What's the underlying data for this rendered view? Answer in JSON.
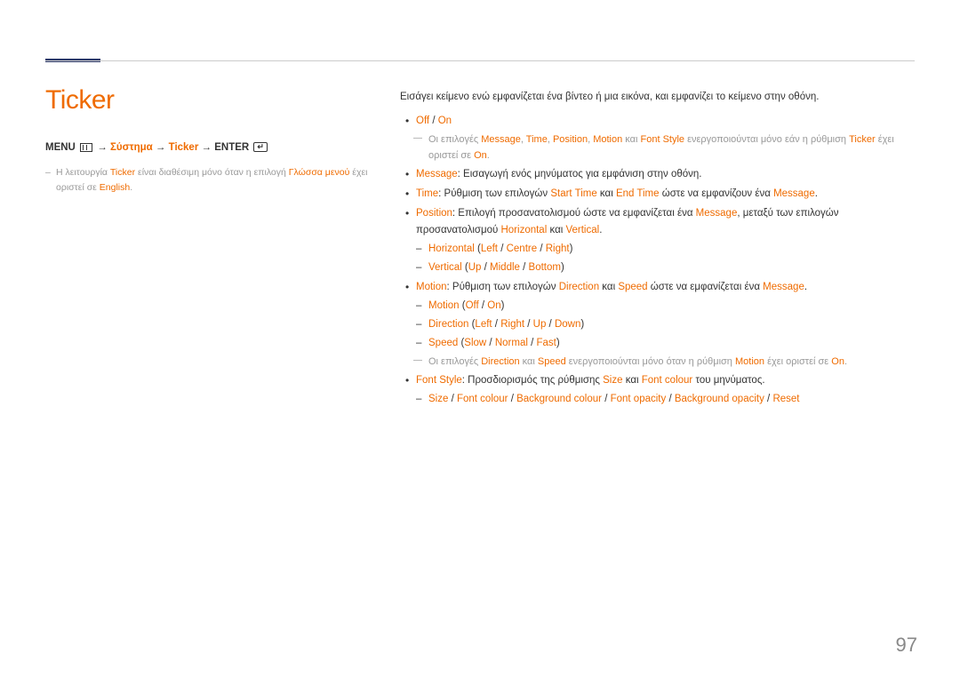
{
  "title": "Ticker",
  "breadcrumb": {
    "menu": "MENU",
    "arrow": "→",
    "system": "Σύστημα",
    "ticker": "Ticker",
    "enter": "ENTER"
  },
  "left_note": {
    "p1": "Η λειτουργία ",
    "ticker": "Ticker",
    "p2": " είναι διαθέσιμη μόνο όταν η επιλογή ",
    "lang": "Γλώσσα μενού",
    "p3": " έχει οριστεί σε ",
    "english": "English",
    "p4": "."
  },
  "intro": "Εισάγει κείμενο ενώ εμφανίζεται ένα βίντεο ή μια εικόνα, και εμφανίζει το κείμενο στην οθόνη.",
  "off_on": {
    "off": "Off",
    "slash": " / ",
    "on": "On"
  },
  "offon_note": {
    "p1": "Οι επιλογές ",
    "msg": "Message",
    "c1": ", ",
    "time": "Time",
    "c2": ", ",
    "pos": "Position",
    "c3": ", ",
    "mot": "Motion",
    "c4": " και ",
    "fs": "Font Style",
    "p2": " ενεργοποιούνται μόνο εάν η ρύθμιση ",
    "tk": "Ticker",
    "p3": " έχει οριστεί σε ",
    "on": "On",
    "p4": "."
  },
  "message": {
    "lbl": "Message",
    "txt": ": Εισαγωγή ενός μηνύματος για εμφάνιση στην οθόνη."
  },
  "time": {
    "lbl": "Time",
    "p1": ": Ρύθμιση των επιλογών ",
    "st": "Start Time",
    "and": " και ",
    "et": "End Time",
    "p2": " ώστε να εμφανίζουν ένα ",
    "msg": "Message",
    "p3": "."
  },
  "position": {
    "lbl": "Position",
    "p1": ": Επιλογή προσανατολισμού ώστε να εμφανίζεται ένα ",
    "msg": "Message",
    "p2": ", μεταξύ των επιλογών προσανατολισμού ",
    "hor": "Horizontal",
    "and": " και ",
    "ver": "Vertical",
    "p3": "."
  },
  "pos_h": {
    "lbl": "Horizontal",
    "o1": "Left",
    "o2": "Centre",
    "o3": "Right"
  },
  "pos_v": {
    "lbl": "Vertical",
    "o1": "Up",
    "o2": "Middle",
    "o3": "Bottom"
  },
  "motion": {
    "lbl": "Motion",
    "p1": ": Ρύθμιση των επιλογών ",
    "dir": "Direction",
    "and": " και ",
    "spd": "Speed",
    "p2": " ώστε να εμφανίζεται ένα ",
    "msg": "Message",
    "p3": "."
  },
  "mot_onoff": {
    "lbl": "Motion",
    "o1": "Off",
    "o2": "On"
  },
  "mot_dir": {
    "lbl": "Direction",
    "o1": "Left",
    "o2": "Right",
    "o3": "Up",
    "o4": "Down"
  },
  "mot_spd": {
    "lbl": "Speed",
    "o1": "Slow",
    "o2": "Normal",
    "o3": "Fast"
  },
  "motion_note": {
    "p1": "Οι επιλογές ",
    "dir": "Direction",
    "and": " και ",
    "spd": "Speed",
    "p2": " ενεργοποιούνται μόνο όταν η ρύθμιση ",
    "mot": "Motion",
    "p3": " έχει οριστεί σε ",
    "on": "On",
    "p4": "."
  },
  "fontstyle": {
    "lbl": "Font Style",
    "p1": ": Προσδιορισμός της ρύθμισης ",
    "sz": "Size",
    "and": " και ",
    "fc": "Font colour",
    "p2": " του μηνύματος."
  },
  "fs_opts": {
    "o1": "Size",
    "o2": "Font colour",
    "o3": "Background colour",
    "o4": "Font opacity",
    "o5": "Background opacity",
    "o6": "Reset"
  },
  "page": "97"
}
